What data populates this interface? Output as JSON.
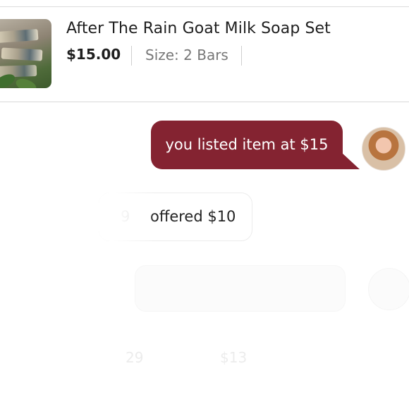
{
  "listing": {
    "title": "After The Rain Goat Milk Soap Set",
    "price": "$15.00",
    "size": "Size: 2 Bars"
  },
  "messages": [
    {
      "side": "right",
      "text": "you listed item at $15"
    },
    {
      "side": "left",
      "faded_prefix": "9",
      "text": "offered $10"
    }
  ],
  "ghost": {
    "prefix": "29",
    "amount": "$13"
  },
  "colors": {
    "bubble_outgoing": "#842331",
    "bubble_outgoing_text": "#ffffff",
    "divider": "#d8d8d8"
  }
}
